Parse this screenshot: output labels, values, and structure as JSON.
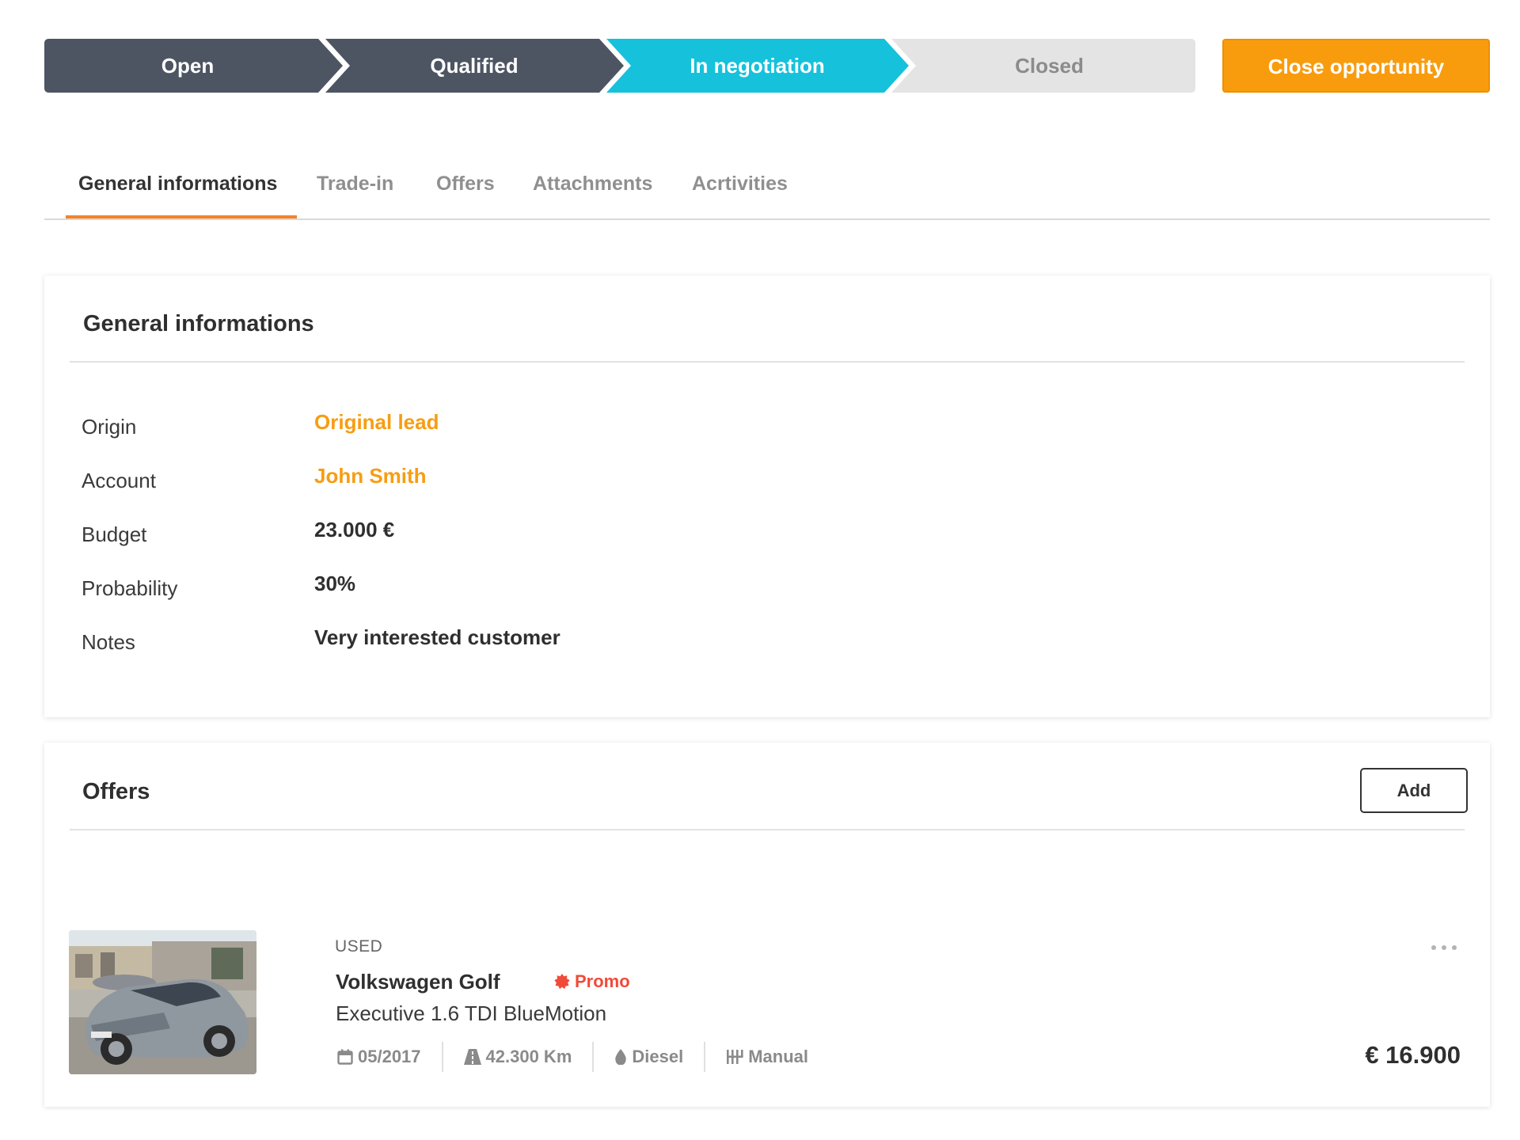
{
  "pipeline": {
    "stages": [
      {
        "label": "Open",
        "state": "done"
      },
      {
        "label": "Qualified",
        "state": "done"
      },
      {
        "label": "In negotiation",
        "state": "current"
      },
      {
        "label": "Closed",
        "state": "pending"
      }
    ],
    "close_button_label": "Close opportunity"
  },
  "tabs": [
    {
      "label": "General informations",
      "active": true
    },
    {
      "label": "Trade-in",
      "active": false
    },
    {
      "label": "Offers",
      "active": false
    },
    {
      "label": "Attachments",
      "active": false
    },
    {
      "label": "Acrtivities",
      "active": false
    }
  ],
  "general": {
    "title": "General informations",
    "fields": [
      {
        "label": "Origin",
        "value": "Original lead",
        "link": true
      },
      {
        "label": "Account",
        "value": "John Smith",
        "link": true
      },
      {
        "label": "Budget",
        "value": "23.000 €",
        "link": false
      },
      {
        "label": "Probability",
        "value": "30%",
        "link": false
      },
      {
        "label": "Notes",
        "value": "Very interested customer",
        "link": false
      }
    ]
  },
  "offers": {
    "title": "Offers",
    "add_label": "Add",
    "items": [
      {
        "condition": "USED",
        "name": "Volkswagen Golf",
        "badge": "Promo",
        "variant": "Executive 1.6 TDI BlueMotion",
        "date": "05/2017",
        "mileage": "42.300 Km",
        "fuel": "Diesel",
        "transmission": "Manual",
        "price": "€ 16.900"
      }
    ]
  },
  "colors": {
    "stage_done": "#4d5563",
    "stage_current": "#16c1dc",
    "stage_pending": "#e4e4e4",
    "accent_orange": "#f89c0e",
    "promo_red": "#f04b3a"
  },
  "icons": [
    "calendar-icon",
    "road-icon",
    "fuel-drop-icon",
    "gearbox-icon",
    "promo-badge-icon",
    "more-dots-icon",
    "car-photo"
  ]
}
